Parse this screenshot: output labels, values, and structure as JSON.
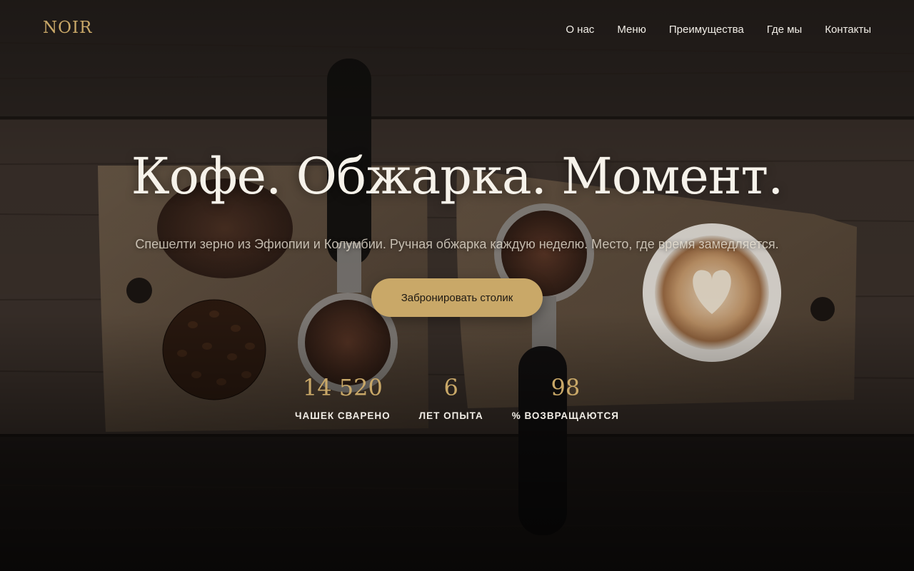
{
  "brand": {
    "logo": "NOIR",
    "accent_color": "#c9a868"
  },
  "nav": {
    "items": [
      {
        "label": "О нас"
      },
      {
        "label": "Меню"
      },
      {
        "label": "Преимущества"
      },
      {
        "label": "Где мы"
      },
      {
        "label": "Контакты"
      }
    ]
  },
  "hero": {
    "headline": "Кофе. Обжарка. Момент.",
    "subtitle": "Спешелти зерно из Эфиопии и Колумбии. Ручная обжарка каждую неделю. Место, где время замедляется.",
    "cta_label": "Забронировать столик",
    "background": "coffee-flatlay-on-wooden-board",
    "stats": [
      {
        "value": "14 520",
        "label": "ЧАШЕК СВАРЕНО"
      },
      {
        "value": "6",
        "label": "ЛЕТ ОПЫТА"
      },
      {
        "value": "98",
        "label": "% ВОЗВРАЩАЮТСЯ"
      }
    ]
  }
}
